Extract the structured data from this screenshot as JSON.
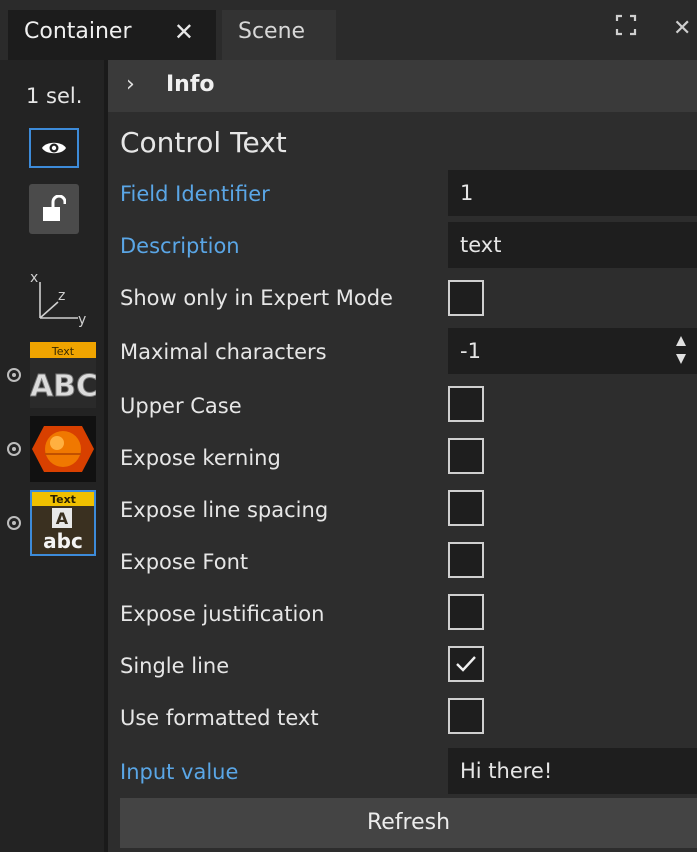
{
  "tabs": [
    {
      "label": "Container",
      "close": "✕"
    },
    {
      "label": "Scene"
    }
  ],
  "window": {
    "maximize_glyph": "⛶",
    "close_glyph": "✕"
  },
  "left_panel": {
    "selection_count": "1 sel.",
    "axes_labels": {
      "x": "x",
      "z": "z",
      "y": "y"
    },
    "thumbnails": [
      {
        "name": "text-abc",
        "caption": "Text",
        "text": "ABC"
      },
      {
        "name": "sphere"
      },
      {
        "name": "text-abc-lower",
        "caption": "Text",
        "text": "abc",
        "glyph": "A"
      }
    ]
  },
  "info": {
    "chevron": "›",
    "label": "Info"
  },
  "control": {
    "title": "Control Text",
    "fields": [
      {
        "label": "Field Identifier",
        "type": "text",
        "value": "1",
        "link": true
      },
      {
        "label": "Description",
        "type": "text",
        "value": "text",
        "link": true
      },
      {
        "label": "Show only in Expert Mode",
        "type": "checkbox",
        "checked": false
      },
      {
        "label": "Maximal characters",
        "type": "number",
        "value": "-1"
      },
      {
        "label": "Upper Case",
        "type": "checkbox",
        "checked": false
      },
      {
        "label": "Expose kerning",
        "type": "checkbox",
        "checked": false
      },
      {
        "label": "Expose line spacing",
        "type": "checkbox",
        "checked": false
      },
      {
        "label": "Expose Font",
        "type": "checkbox",
        "checked": false
      },
      {
        "label": "Expose justification",
        "type": "checkbox",
        "checked": false
      },
      {
        "label": "Single line",
        "type": "checkbox",
        "checked": true
      },
      {
        "label": "Use formatted text",
        "type": "checkbox",
        "checked": false
      },
      {
        "label": "Input value",
        "type": "text",
        "value": "Hi there!",
        "link": true
      }
    ],
    "refresh_label": "Refresh"
  },
  "colors": {
    "accent": "#3d8bd9",
    "link": "#5aa6e6",
    "background": "#2d2d2d"
  }
}
